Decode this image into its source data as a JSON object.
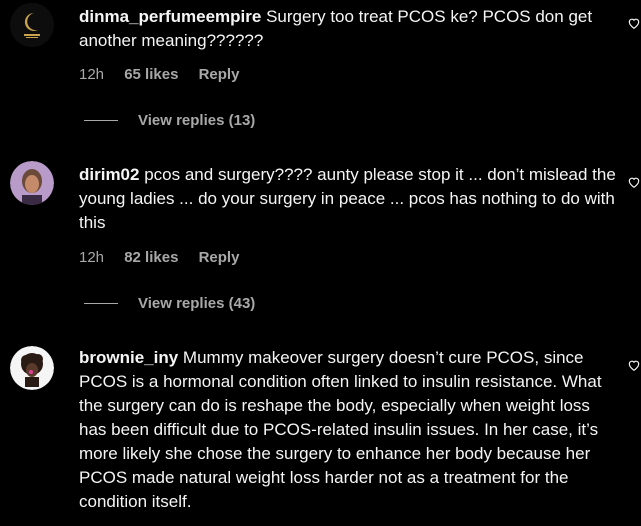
{
  "comments": [
    {
      "username": "dinma_perfumeempire",
      "text": "Surgery too treat PCOS ke? PCOS don get another meaning??????",
      "time": "12h",
      "likes": "65 likes",
      "reply": "Reply",
      "view_replies": "View replies (13)"
    },
    {
      "username": "dirim02",
      "text": "pcos and surgery???? aunty please stop it ... don’t mislead the young ladies ... do your surgery in peace ... pcos has nothing to do with this",
      "time": "12h",
      "likes": "82 likes",
      "reply": "Reply",
      "view_replies": "View replies (43)"
    },
    {
      "username": "brownie_iny",
      "text": "Mummy makeover surgery doesn’t cure PCOS, since PCOS is a hormonal condition often linked to insulin resistance. What the surgery can do is reshape the body, especially when weight loss has been difficult due to PCOS-related insulin issues. In her case, it’s more likely she chose the surgery to enhance her body because her PCOS made natural weight loss harder not as a treatment for the condition itself."
    }
  ],
  "icons": {
    "like": "heart-outline-icon"
  },
  "colors": {
    "background": "#000000",
    "text": "#f5f5f5",
    "muted": "#a8a8a8"
  }
}
